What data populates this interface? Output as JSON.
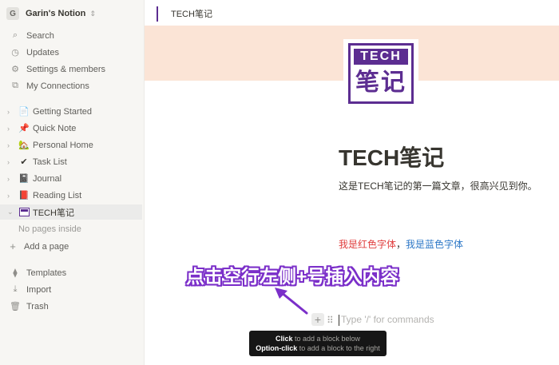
{
  "workspace": {
    "avatar": "G",
    "name": "Garin's Notion",
    "chevron": "⇕"
  },
  "nav": [
    {
      "id": "search",
      "icon": "search-icon",
      "glyph": "⌕",
      "label": "Search"
    },
    {
      "id": "updates",
      "icon": "clock-icon",
      "glyph": "◷",
      "label": "Updates"
    },
    {
      "id": "settings",
      "icon": "gear-icon",
      "glyph": "⚙",
      "label": "Settings & members"
    },
    {
      "id": "connections",
      "icon": "link-icon",
      "glyph": "⧉",
      "label": "My Connections"
    }
  ],
  "pages": [
    {
      "id": "getting-started",
      "icon": "document-icon",
      "glyph": "📄",
      "label": "Getting Started"
    },
    {
      "id": "quick-note",
      "icon": "pin-icon",
      "glyph": "📌",
      "label": "Quick Note"
    },
    {
      "id": "personal-home",
      "icon": "house-icon",
      "glyph": "🏡",
      "label": "Personal Home"
    },
    {
      "id": "task-list",
      "icon": "checkmark-icon",
      "glyph": "✔",
      "label": "Task List"
    },
    {
      "id": "journal",
      "icon": "notebook-icon",
      "glyph": "📓",
      "label": "Journal"
    },
    {
      "id": "reading-list",
      "icon": "book-icon",
      "glyph": "📕",
      "label": "Reading List"
    },
    {
      "id": "tech",
      "icon": "tech-logo-icon",
      "glyph": "",
      "label": "TECH笔记",
      "active": true
    }
  ],
  "empty_text": "No pages inside",
  "add_page": "Add a page",
  "footer_nav": [
    {
      "id": "templates",
      "icon": "templates-icon",
      "glyph": "⧫",
      "label": "Templates"
    },
    {
      "id": "import",
      "icon": "download-icon",
      "glyph": "⤓",
      "label": "Import"
    },
    {
      "id": "trash",
      "icon": "trash-icon",
      "glyph": "🗑",
      "label": "Trash"
    }
  ],
  "breadcrumb": "TECH笔记",
  "logo": {
    "top": "TECH",
    "bottom": "笔记"
  },
  "page": {
    "title": "TECH笔记",
    "intro": "这是TECH笔记的第一篇文章，很高兴见到你。",
    "red_text": "我是红色字体",
    "separator": "，",
    "blue_text": "我是蓝色字体"
  },
  "annotation": "点击空行左侧+号插入内容",
  "editor": {
    "plus": "+",
    "drag": "⠿",
    "placeholder": "Type '/' for commands"
  },
  "tooltip": {
    "line1_bold": "Click",
    "line1_rest": " to add a block below",
    "line2_bold": "Option-click",
    "line2_rest": " to add a block to the right"
  },
  "colors": {
    "accent": "#5c2d91",
    "cover": "#fbe4d6",
    "red": "#e03e3e",
    "blue": "#2e78c7",
    "annotation": "#7b2fc9"
  }
}
